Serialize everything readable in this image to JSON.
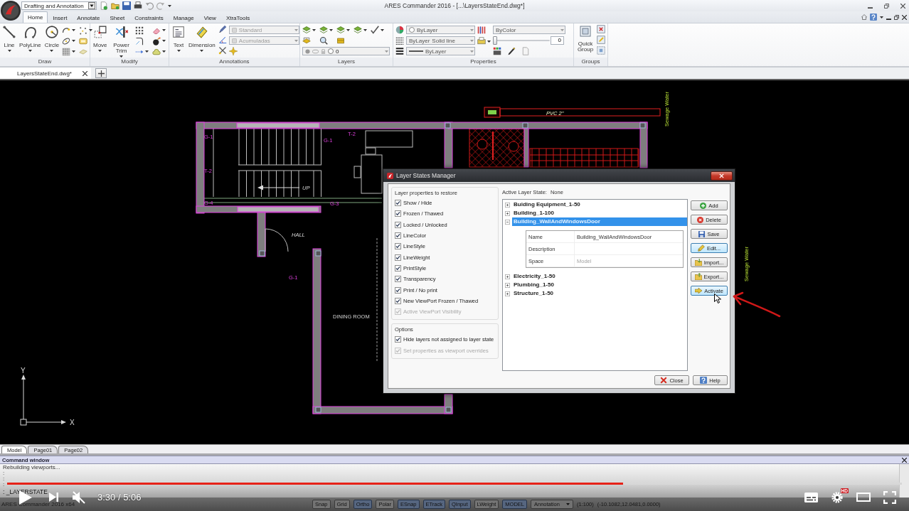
{
  "app": {
    "workspace": "Drafting and Annotation",
    "title": "ARES Commander 2016 - [...\\LayersStateEnd.dwg*]"
  },
  "ribbon_tabs": [
    {
      "label": "Home",
      "selected": true
    },
    {
      "label": "Insert",
      "selected": false
    },
    {
      "label": "Annotate",
      "selected": false
    },
    {
      "label": "Sheet",
      "selected": false
    },
    {
      "label": "Constraints",
      "selected": false
    },
    {
      "label": "Manage",
      "selected": false
    },
    {
      "label": "View",
      "selected": false
    },
    {
      "label": "XtraTools",
      "selected": false
    }
  ],
  "ribbon": {
    "draw": {
      "title": "Draw",
      "tools": [
        "Line",
        "PolyLine",
        "Circle"
      ]
    },
    "modify": {
      "title": "Modify",
      "tools": [
        "Move",
        "Power Trim"
      ]
    },
    "annotations": {
      "title": "Annotations",
      "tools": [
        "Text",
        "Dimension"
      ],
      "text_style": {
        "value": "Standard",
        "disabled": true
      },
      "dimension_style": {
        "value": "Acumuladas",
        "disabled": true
      }
    },
    "layers": {
      "title": "Layers",
      "current_layer": "0"
    },
    "properties": {
      "title": "Properties",
      "color_setting": "ByLayer",
      "linestyle": "ByLayer",
      "linestyle_name": "Solid line",
      "lineweight": "ByLayer",
      "print_style": "ByColor",
      "transparency": {
        "level": 0,
        "value": "0"
      }
    },
    "groups": {
      "title": "Groups",
      "tools": [
        "Quick Group"
      ]
    }
  },
  "document_tabs": [
    {
      "label": "LayersStateEnd.dwg*",
      "selected": true
    }
  ],
  "drawing": {
    "labels": [
      "G-1",
      "T-2",
      "G-4",
      "G-1",
      "T-2",
      "G-3",
      "UP",
      "HALL",
      "G-1",
      "DINING ROOM",
      "PVC 2\"",
      "Sewage Water",
      "Sewage Water"
    ],
    "axes": {
      "x": "X",
      "y": "Y"
    }
  },
  "dialog": {
    "title": "Layer States Manager",
    "restore_group": {
      "title": "Layer properties to restore",
      "options": [
        {
          "label": "Show / Hide",
          "checked": true,
          "disabled": false
        },
        {
          "label": "Frozen / Thawed",
          "checked": true,
          "disabled": false
        },
        {
          "label": "Locked / Unlocked",
          "checked": true,
          "disabled": false
        },
        {
          "label": "LineColor",
          "checked": true,
          "disabled": false
        },
        {
          "label": "LineStyle",
          "checked": true,
          "disabled": false
        },
        {
          "label": "LineWeight",
          "checked": true,
          "disabled": false
        },
        {
          "label": "PrintStyle",
          "checked": true,
          "disabled": false
        },
        {
          "label": "Transparency",
          "checked": true,
          "disabled": false
        },
        {
          "label": "Print / No print",
          "checked": true,
          "disabled": false
        },
        {
          "label": "New ViewPort Frozen / Thawed",
          "checked": true,
          "disabled": false
        },
        {
          "label": "Active ViewPort Visibility",
          "checked": true,
          "disabled": true
        }
      ]
    },
    "options_group": {
      "title": "Options",
      "options": [
        {
          "label": "Hide layers not assigned to layer state",
          "checked": true,
          "disabled": false
        },
        {
          "label": "Set properties as viewport overrides",
          "checked": true,
          "disabled": true
        }
      ]
    },
    "active_state": {
      "label": "Active Layer State:",
      "value": "None"
    },
    "layer_states": [
      {
        "name": "Buiding Equipment_1-50",
        "expanded": false,
        "selected": false
      },
      {
        "name": "Building_1-100",
        "expanded": false,
        "selected": false
      },
      {
        "name": "Building_WallAndWindowsDoor",
        "expanded": true,
        "selected": true,
        "details": [
          {
            "label": "Name",
            "value": "Building_WallAndWindowsDoor",
            "disabled": false
          },
          {
            "label": "Description",
            "disabled": false
          },
          {
            "label": "Space",
            "value": "Model",
            "disabled": true
          }
        ]
      },
      {
        "name": "Electricity_1-50",
        "expanded": false,
        "selected": false
      },
      {
        "name": "Plumbing_1-50",
        "expanded": false,
        "selected": false
      },
      {
        "name": "Structure_1-50",
        "expanded": false,
        "selected": false
      }
    ],
    "side_buttons": [
      {
        "label": "Add",
        "kind": "add",
        "highlighted": false
      },
      {
        "label": "Delete",
        "kind": "delete",
        "highlighted": false
      },
      {
        "label": "Save",
        "kind": "save",
        "highlighted": false
      },
      {
        "label": "Edit...",
        "kind": "edit",
        "highlighted": true
      },
      {
        "label": "Import...",
        "kind": "import",
        "highlighted": false
      },
      {
        "label": "Export...",
        "kind": "export",
        "highlighted": false
      },
      {
        "label": "Activate",
        "kind": "activate",
        "highlighted": true
      }
    ],
    "footer_buttons": [
      {
        "label": "Close",
        "kind": "close"
      },
      {
        "label": "Help",
        "kind": "help"
      }
    ]
  },
  "layout_tabs": [
    {
      "label": "Model",
      "selected": true
    },
    {
      "label": "Page01",
      "selected": false
    },
    {
      "label": "Page02",
      "selected": false
    }
  ],
  "command_window": {
    "title": "Command window",
    "history": [
      "Rebuilding viewports...",
      ":",
      ":",
      ":"
    ],
    "prompt": ": _LAYERSTATE"
  },
  "status_bar": {
    "app": "ARES Commander 2016 x64",
    "toggles": [
      {
        "label": "Snap",
        "on": false
      },
      {
        "label": "Grid",
        "on": false
      },
      {
        "label": "Ortho",
        "on": true
      },
      {
        "label": "Polar",
        "on": false
      },
      {
        "label": "ESnap",
        "on": true
      },
      {
        "label": "ETrack",
        "on": true
      },
      {
        "label": "QInput",
        "on": true
      },
      {
        "label": "LWeight",
        "on": false
      },
      {
        "label": "MODEL",
        "on": true
      }
    ],
    "annotation": "Annotation",
    "scale": "(1:100)",
    "coordinates": "(-10.1082,12.0481,0.0000)"
  },
  "video_player": {
    "progress": {
      "level": 0.688
    },
    "muted": true,
    "time": "3:30 / 5:06",
    "quality_badge": "HD"
  }
}
